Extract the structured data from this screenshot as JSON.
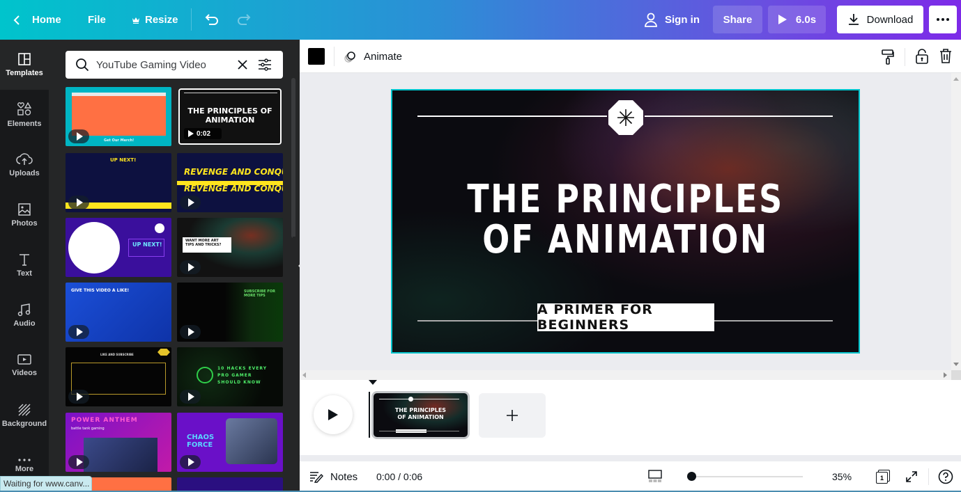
{
  "topbar": {
    "home_label": "Home",
    "file_label": "File",
    "resize_label": "Resize",
    "signin_label": "Sign in",
    "share_label": "Share",
    "play_duration": "6.0s",
    "download_label": "Download"
  },
  "rail": {
    "items": [
      {
        "label": "Templates",
        "icon": "templates-icon"
      },
      {
        "label": "Elements",
        "icon": "elements-icon"
      },
      {
        "label": "Uploads",
        "icon": "uploads-icon"
      },
      {
        "label": "Photos",
        "icon": "photos-icon"
      },
      {
        "label": "Text",
        "icon": "text-icon"
      },
      {
        "label": "Audio",
        "icon": "audio-icon"
      },
      {
        "label": "Videos",
        "icon": "videos-icon"
      },
      {
        "label": "Background",
        "icon": "background-icon"
      },
      {
        "label": "More",
        "icon": "more-icon"
      }
    ]
  },
  "search": {
    "value": "YouTube Gaming Video"
  },
  "templates": [
    {
      "title": "Get Our Merch!",
      "bg": "#00b5c3"
    },
    {
      "title": "THE PRINCIPLES OF ANIMATION",
      "duration": "0:02",
      "bg": "#111"
    },
    {
      "title": "UP NEXT!",
      "bg": "#0d1140"
    },
    {
      "title": "REVENGE AND CONQUER",
      "bg": "#0d1140"
    },
    {
      "title": "UP NEXT!",
      "bg": "#3a0f9c"
    },
    {
      "title": "WANT MORE ART TIPS AND TRICKS?",
      "bg": "#121212"
    },
    {
      "title": "GIVE THIS VIDEO A LIKE!",
      "bg": "#1541c7"
    },
    {
      "title": "SUBSCRIBE FOR MORE TIPS",
      "bg": "#050505"
    },
    {
      "title": "LIKE AND SUBSCRIBE",
      "bg": "#050505"
    },
    {
      "title": "10 HACKS EVERY PRO GAMER SHOULD KNOW",
      "bg": "#0a0f0a"
    },
    {
      "title": "POWER ANTHEM",
      "subtitle": "battle tank gaming",
      "bg": "#6a10b8"
    },
    {
      "title": "CHAOS FORCE",
      "bg": "#6a10c8"
    }
  ],
  "context_bar": {
    "color_swatch": "#000000",
    "animate_label": "Animate"
  },
  "slide": {
    "title_line1": "THE PRINCIPLES",
    "title_line2": "OF ANIMATION",
    "subtitle": "A PRIMER FOR BEGINNERS",
    "accent_border": "#00c4cc"
  },
  "timeline": {
    "thumb_title_line1": "THE PRINCIPLES",
    "thumb_title_line2": "OF ANIMATION"
  },
  "footer": {
    "notes_label": "Notes",
    "time": "0:00 / 0:06",
    "zoom": "35%",
    "zoom_fraction": 0.0,
    "page_count": "1"
  },
  "status": {
    "text": "Waiting for www.canv..."
  }
}
